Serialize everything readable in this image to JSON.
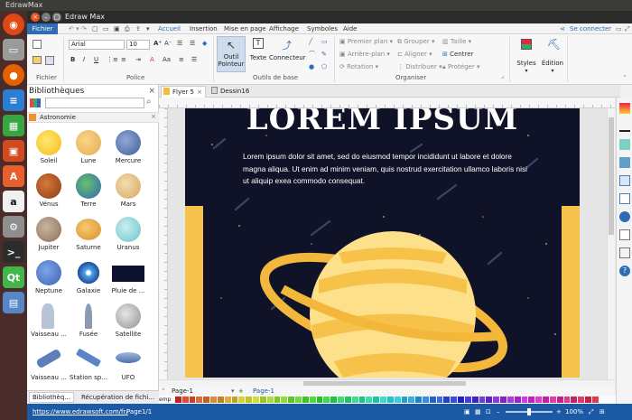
{
  "os": {
    "title": "EdrawMax"
  },
  "window": {
    "title": "Edraw Max",
    "close": "×",
    "minimize": "–",
    "maximize": "□"
  },
  "menu": {
    "file": "Fichier",
    "tabs": [
      "Accueil",
      "Insertion",
      "Mise en page",
      "Affichage",
      "Symboles",
      "Aide"
    ],
    "connect": "Se connecter"
  },
  "ribbon": {
    "font": "Arial",
    "size": "10",
    "groups": {
      "fichier": "Fichier",
      "police": "Police",
      "outils": "Outils de base",
      "organiser": "Organiser"
    },
    "outil_pointeur": "Outil Pointeur",
    "texte": "Texte",
    "connecteur": "Connecteur",
    "premier_plan": "Premier plan",
    "arriere_plan": "Arrière-plan",
    "rotation": "Rotation",
    "grouper": "Grouper",
    "aligner": "Aligner",
    "distribuer": "Distribuer",
    "taille": "Taille",
    "centrer": "Centrer",
    "proteger": "Protéger",
    "styles": "Styles",
    "edition": "Édition"
  },
  "library": {
    "title": "Bibliothèques",
    "category": "Astronomie",
    "shapes": [
      {
        "label": "Soleil"
      },
      {
        "label": "Lune"
      },
      {
        "label": "Mercure"
      },
      {
        "label": "Vénus"
      },
      {
        "label": "Terre"
      },
      {
        "label": "Mars"
      },
      {
        "label": "Jupiter"
      },
      {
        "label": "Saturne"
      },
      {
        "label": "Uranus"
      },
      {
        "label": "Neptune"
      },
      {
        "label": "Galaxie"
      },
      {
        "label": "Pluie de ..."
      },
      {
        "label": "Vaisseau ..."
      },
      {
        "label": "Fusée"
      },
      {
        "label": "Satellite"
      },
      {
        "label": "Vaisseau ..."
      },
      {
        "label": "Station sp..."
      },
      {
        "label": "UFO"
      }
    ],
    "tabs": [
      "Bibliothèq...",
      "Récupération de fichi..."
    ]
  },
  "doc_tabs": [
    "Flyer 5",
    "Dessin16"
  ],
  "canvas": {
    "heading": "LOREM IPSUM",
    "body": "Lorem ipsum dolor sit amet,  sed do eiusmod tempor incididunt ut labore et dolore magna aliqua. Ut enim ad minim veniam, quis nostrud exercitation ullamco laboris nisi ut aliquip exea commodo consequat."
  },
  "pages": {
    "tab_left": "Page-1",
    "tab_active": "Page-1"
  },
  "status": {
    "url": "https://www.edrawsoft.com/fr/",
    "page": "Page1/1",
    "zoom": "100%"
  },
  "palette_label": "emp",
  "colors": {
    "space": "#101328",
    "planet_light": "#fde08a",
    "planet_dark": "#f3b73c",
    "accent_bar": "#f5c34c",
    "status_blue": "#1d5aa6"
  }
}
